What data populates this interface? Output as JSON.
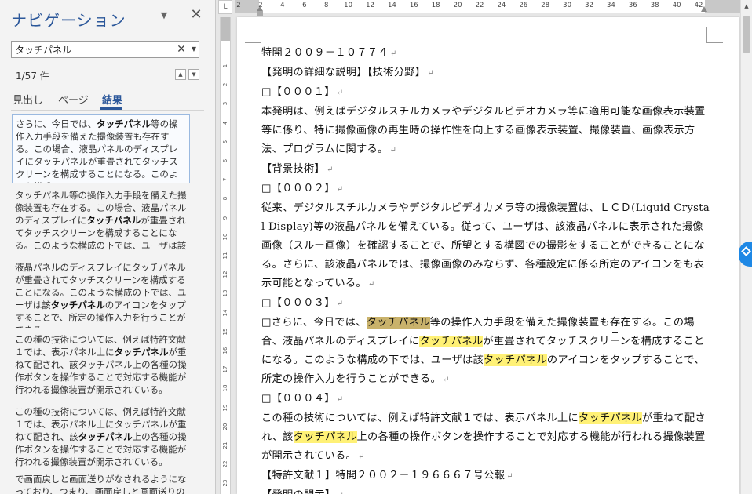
{
  "nav": {
    "title": "ナビゲーション",
    "menu_icon": "chevron-down-icon",
    "close_icon": "close-icon",
    "search": {
      "value": "タッチパネル",
      "clear_icon": "close-icon",
      "dropdown_icon": "caret-down-icon"
    },
    "result_count": "1/57 件",
    "tabs": [
      "見出し",
      "ページ",
      "結果"
    ],
    "active_tab": "結果",
    "results": [
      {
        "pre": "さらに、今日では、",
        "match": "タッチパネル",
        "post": "等の操作入力手段を備えた撮像装置も存在する。この場合、液晶パネルのディスプレイにタッチパネルが重畳されてタッチスクリーンを構成することになる。このような構成の下では、"
      },
      {
        "pre": "タッチパネル等の操作入力手段を備えた撮像装置も存在する。この場合、液晶パネルのディスプレイに",
        "match": "タッチパネル",
        "post": "が重畳されてタッチスクリーンを構成することになる。このような構成の下では、ユーザは該"
      },
      {
        "pre": "液晶パネルのディスプレイにタッチパネルが重畳されてタッチスクリーンを構成することになる。このような構成の下では、ユーザは該",
        "match": "タッチパネル",
        "post": "のアイコンをタップすることで、所定の操作入力を行うことができる。"
      },
      {
        "pre": "この種の技術については、例えば特許文献１では、表示パネル上に",
        "match": "タッチパネル",
        "post": "が重ねて配され、該タッチパネル上の各種の操作ボタンを操作することで対応する機能が行われる撮像装置が開示されている。"
      },
      {
        "pre": "この種の技術については、例えば特許文献１では、表示パネル上にタッチパネルが重ねて配され、該",
        "match": "タッチパネル",
        "post": "上の各種の操作ボタンを操作することで対応する機能が行われる撮像装置が開示されている。"
      },
      {
        "pre": "で画面戻しと画面送りがなされるようになっており、つまり、画面戻しと画面送りの操作が",
        "match": "",
        "post": ""
      }
    ]
  },
  "ruler": {
    "corner": "L",
    "h_numbers": [
      "2",
      "2",
      "4",
      "6",
      "8",
      "10",
      "12",
      "14",
      "16",
      "18",
      "20",
      "22",
      "24",
      "26",
      "28",
      "30",
      "32",
      "34",
      "36",
      "38",
      "40",
      "42"
    ],
    "v_numbers": [
      "1",
      "2",
      "3",
      "4",
      "5",
      "6",
      "7",
      "8",
      "9",
      "10",
      "11",
      "12",
      "13",
      "14",
      "15",
      "16",
      "17",
      "18",
      "19",
      "20",
      "21",
      "22",
      "23"
    ]
  },
  "document": {
    "paragraphs": [
      [
        {
          "t": "特開２００９－１０７７４"
        }
      ],
      [
        {
          "t": "【発明の詳細な説明】【技術分野】"
        }
      ],
      [
        {
          "t": "□【０００１】"
        }
      ],
      [
        {
          "t": "本発明は、例えばデジタルスチルカメラやデジタルビデオカメラ等に適用可能な画像表示装置等に係り、特に撮像画像の再生時の操作性を向上する画像表示装置、撮像装置、画像表示方法、プログラムに関する。"
        }
      ],
      [
        {
          "t": "【背景技術】"
        }
      ],
      [
        {
          "t": "□【０００２】"
        }
      ],
      [
        {
          "t": "従来、デジタルスチルカメラやデジタルビデオカメラ等の撮像装置は、ＬＣＤ(Liquid Crystal Display)等の液晶パネルを備えている。従って、ユーザは、該液晶パネルに表示された撮像画像（スルー画像）を確認することで、所望とする構図での撮影をすることができることになる。さらに、該液晶パネルでは、撮像画像のみならず、各種設定に係る所定のアイコンをも表示可能となっている。"
        }
      ],
      [
        {
          "t": "□【０００３】"
        }
      ],
      [
        {
          "t": "□さらに、今日では、"
        },
        {
          "t": "タッチパネル",
          "h": "cur"
        },
        {
          "t": "等の操作入力手段を備えた撮像装置も存在する。この場合、液晶パネルのディスプレイに"
        },
        {
          "t": "タッチパネル",
          "h": "hl"
        },
        {
          "t": "が重畳されてタッチスクリーンを構成することになる。このような構成の下では、ユーザは該"
        },
        {
          "t": "タッチパネル",
          "h": "hl"
        },
        {
          "t": "のアイコンをタップすることで、所定の操作入力を行うことができる。"
        }
      ],
      [
        {
          "t": "□【０００４】"
        }
      ],
      [
        {
          "t": "この種の技術については、例えば特許文献１では、表示パネル上に"
        },
        {
          "t": "タッチパネル",
          "h": "hl"
        },
        {
          "t": "が重ねて配され、該"
        },
        {
          "t": "タッチパネル",
          "h": "hl"
        },
        {
          "t": "上の各種の操作ボタンを操作することで対応する機能が行われる撮像装置が開示されている。"
        }
      ],
      [
        {
          "t": "【特許文献１】特開２００２－１９６６６７号公報"
        }
      ],
      [
        {
          "t": "【発明の開示】"
        }
      ]
    ],
    "paragraph_mark": "↵",
    "highlight_color": "#fff176",
    "current_match_color": "#c9b26b"
  },
  "accent_color": "#2b579a",
  "side_bubble_color": "#1e88e5"
}
